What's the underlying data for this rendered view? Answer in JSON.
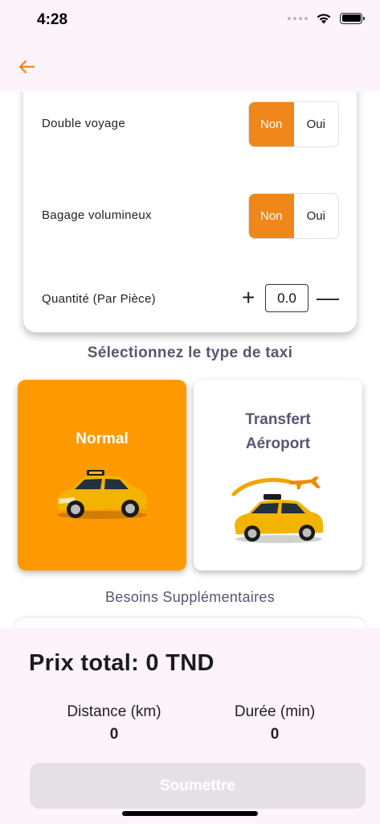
{
  "status_bar": {
    "time": "4:28",
    "icons": [
      "cellular-dots-icon",
      "wifi-icon",
      "battery-icon"
    ]
  },
  "app_bar": {
    "back_icon": "arrow-left-icon",
    "accent": "#f0871b"
  },
  "options": [
    {
      "label": "Double voyage",
      "choices": [
        "Non",
        "Oui"
      ],
      "selected": "Non"
    },
    {
      "label": "Bagage volumineux",
      "choices": [
        "Non",
        "Oui"
      ],
      "selected": "Non"
    }
  ],
  "quantity": {
    "label": "Quantité (Par Pièce)",
    "value": "0.0",
    "plus": "+",
    "minus": "—"
  },
  "taxi_section": {
    "title": "Sélectionnez le type de taxi",
    "types": [
      {
        "label": "Normal",
        "selected": true,
        "icon": "taxi-car-icon"
      },
      {
        "label": "Transfert Aéroport",
        "label_lines": [
          "Transfert",
          "Aéroport"
        ],
        "selected": false,
        "icon": "airport-taxi-icon"
      }
    ],
    "selected_color": "#fe9902"
  },
  "besoins": {
    "title": "Besoins Supplémentaires"
  },
  "summary": {
    "total": "Prix total: 0 TND",
    "distance_label": "Distance (km)",
    "distance_value": "0",
    "duree_label": "Durée (min)",
    "duree_value": "0",
    "submit_label": "Soumettre"
  }
}
